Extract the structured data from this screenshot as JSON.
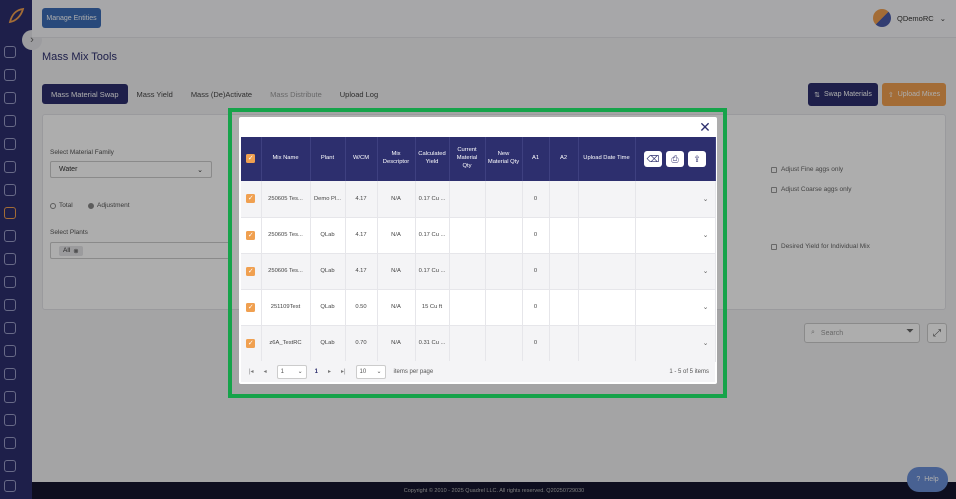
{
  "header": {
    "manage_label": "Manage Entities",
    "user_name": "QDemoRC"
  },
  "page": {
    "title": "Mass Mix Tools",
    "tabs": [
      {
        "label": "Mass Material Swap"
      },
      {
        "label": "Mass Yield"
      },
      {
        "label": "Mass (De)Activate"
      },
      {
        "label": "Mass Distribute"
      },
      {
        "label": "Upload Log"
      }
    ],
    "swap_label": "Swap Materials",
    "upload_label": "Upload Mixes"
  },
  "form": {
    "family_label": "Select Material Family",
    "family_value": "Water",
    "radio_total": "Total",
    "radio_adjustment": "Adjustment",
    "plants_label": "Select Plants",
    "plants_chip": "All",
    "opt_fine": "Adjust Fine aggs only",
    "opt_coarse": "Adjust Coarse aggs only",
    "opt_yield": "Desired Yield for Individual Mix"
  },
  "search": {
    "placeholder": "Search"
  },
  "footer": {
    "text": "Copyright © 2010 - 2025 Quadrel LLC. All rights reserved. Q20250729030"
  },
  "help_label": "Help",
  "modal": {
    "columns": [
      "Mix Name",
      "Plant",
      "W/CM",
      "Mix Descriptor",
      "Calculated Yield",
      "Current Material Qty",
      "New Material Qty",
      "A1",
      "A2",
      "Upload Date Time"
    ],
    "rows": [
      {
        "mix": "250605 Tes...",
        "plant": "Demo Pl...",
        "wcm": "4.17",
        "desc": "N/A",
        "yield": "0.17 Cu ...",
        "cur": "",
        "new": "",
        "a1": "0",
        "a2": "",
        "date": ""
      },
      {
        "mix": "250605 Tes...",
        "plant": "QLab",
        "wcm": "4.17",
        "desc": "N/A",
        "yield": "0.17 Cu ...",
        "cur": "",
        "new": "",
        "a1": "0",
        "a2": "",
        "date": ""
      },
      {
        "mix": "250606 Tes...",
        "plant": "QLab",
        "wcm": "4.17",
        "desc": "N/A",
        "yield": "0.17 Cu ...",
        "cur": "",
        "new": "",
        "a1": "0",
        "a2": "",
        "date": ""
      },
      {
        "mix": "251109Test",
        "plant": "QLab",
        "wcm": "0.50",
        "desc": "N/A",
        "yield": "15 Cu ft",
        "cur": "",
        "new": "",
        "a1": "0",
        "a2": "",
        "date": ""
      },
      {
        "mix": "z6A_TestRC",
        "plant": "QLab",
        "wcm": "0.70",
        "desc": "N/A",
        "yield": "0.31 Cu ...",
        "cur": "",
        "new": "",
        "a1": "0",
        "a2": "",
        "date": ""
      }
    ],
    "pager": {
      "page_select": "1",
      "current_page": "1",
      "page_size": "10",
      "items_per_page": "items per page",
      "summary": "1 - 5 of 5 items"
    }
  },
  "colors": {
    "navy": "#2d2f6e",
    "orange": "#f0a050",
    "highlight": "#16a34a"
  }
}
